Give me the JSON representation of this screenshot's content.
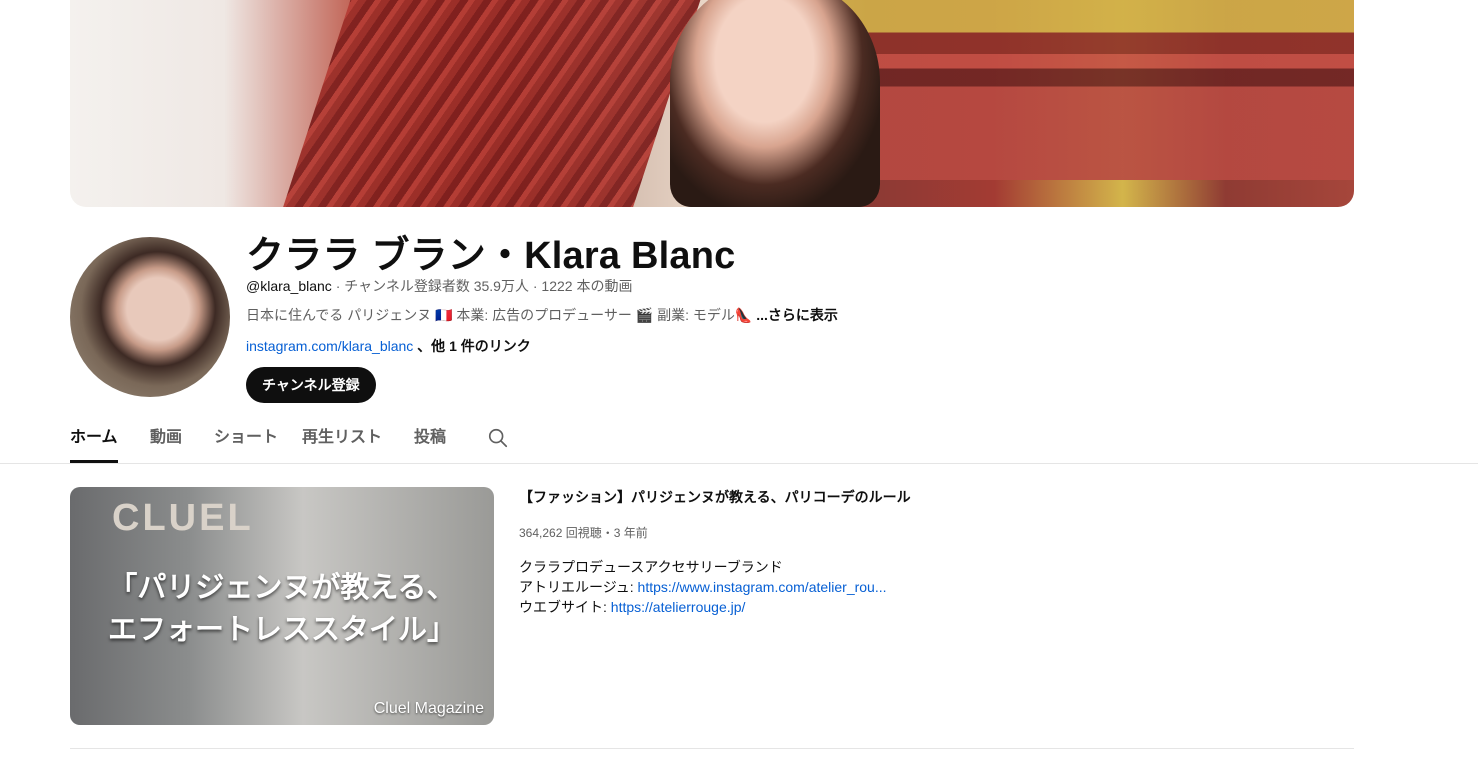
{
  "channel": {
    "title": "クララ ブラン・Klara Blanc",
    "handle": "@klara_blanc",
    "meta": " · チャンネル登録者数 35.9万人 · 1222 本の動画",
    "description": "日本に住んでる パリジェンヌ 🇫🇷 本業: 広告のプロデューサー 🎬 副業: モデル👠",
    "more": " ...さらに表示",
    "link": "instagram.com/klara_blanc",
    "other_links": " 、他 1 件のリンク",
    "subscribe": "チャンネル登録"
  },
  "tabs": [
    {
      "label": "ホーム"
    },
    {
      "label": "動画"
    },
    {
      "label": "ショート"
    },
    {
      "label": "再生リスト"
    },
    {
      "label": "投稿"
    }
  ],
  "video": {
    "thumbnail_caption_line1": "「パリジェンヌが教える、",
    "thumbnail_caption_line2": "エフォートレススタイル」",
    "thumbnail_brand": "Cluel Magazine",
    "thumbnail_logo": "CLUEL",
    "title": "【ファッション】パリジェンヌが教える、パリコーデのルール",
    "meta": "364,262 回視聴・3 年前",
    "desc_line1": "クララプロデュースアクセサリーブランド",
    "desc_line2_label": "アトリエルージュ: ",
    "desc_line2_link": "https://www.instagram.com/atelier_rou...",
    "desc_line3_label": "ウエブサイト: ",
    "desc_line3_link": "https://atelierrouge.jp/"
  },
  "icons": {
    "search": "search-icon"
  }
}
